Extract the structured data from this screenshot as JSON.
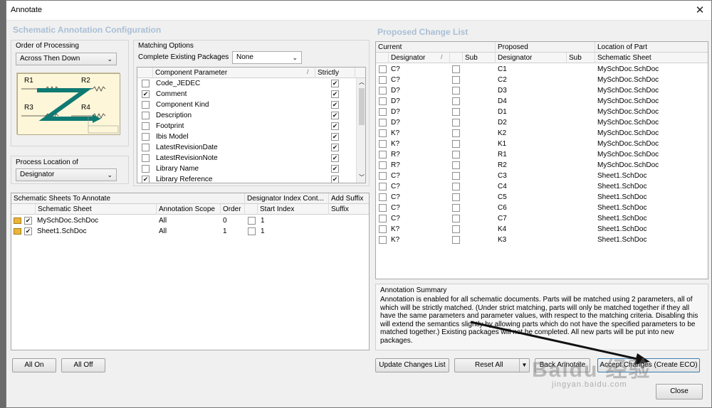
{
  "window": {
    "title": "Annotate"
  },
  "left": {
    "section_title": "Schematic Annotation Configuration",
    "order": {
      "label": "Order of Processing",
      "value": "Across Then Down",
      "diagram": {
        "r1": "R1",
        "r2": "R2",
        "r3": "R3",
        "r4": "R4"
      }
    },
    "process_location": {
      "label": "Process Location of",
      "value": "Designator"
    },
    "matching": {
      "label": "Matching Options",
      "complete_label": "Complete Existing Packages",
      "complete_value": "None",
      "grid_headers": {
        "param": "Component Parameter",
        "strictly": "Strictly"
      },
      "params": [
        {
          "name": "Code_JEDEC",
          "checked": false,
          "strictly": true
        },
        {
          "name": "Comment",
          "checked": true,
          "strictly": true
        },
        {
          "name": "Component Kind",
          "checked": false,
          "strictly": true
        },
        {
          "name": "Description",
          "checked": false,
          "strictly": true
        },
        {
          "name": "Footprint",
          "checked": false,
          "strictly": true
        },
        {
          "name": "Ibis Model",
          "checked": false,
          "strictly": true
        },
        {
          "name": "LatestRevisionDate",
          "checked": false,
          "strictly": true
        },
        {
          "name": "LatestRevisionNote",
          "checked": false,
          "strictly": true
        },
        {
          "name": "Library Name",
          "checked": false,
          "strictly": true
        },
        {
          "name": "Library Reference",
          "checked": true,
          "strictly": true
        }
      ]
    },
    "sheets": {
      "group_headers": {
        "sheets": "Schematic Sheets To Annotate",
        "designator": "Designator Index Cont...",
        "suffix": "Add Suffix"
      },
      "col_headers": {
        "sheet": "Schematic Sheet",
        "scope": "Annotation Scope",
        "order": "Order",
        "start": "Start Index",
        "suffix": "Suffix"
      },
      "rows": [
        {
          "sheet": "MySchDoc.SchDoc",
          "scope": "All",
          "order": "0",
          "start": "1"
        },
        {
          "sheet": "Sheet1.SchDoc",
          "scope": "All",
          "order": "1",
          "start": "1"
        }
      ]
    },
    "buttons": {
      "all_on": "All On",
      "all_off": "All Off"
    }
  },
  "right": {
    "section_title": "Proposed Change List",
    "group_headers": {
      "current": "Current",
      "proposed": "Proposed",
      "location": "Location of Part"
    },
    "col_headers": {
      "designator": "Designator",
      "sub": "Sub",
      "pdesignator": "Designator",
      "psub": "Sub",
      "sheet": "Schematic Sheet"
    },
    "rows": [
      {
        "cur": "C?",
        "prop": "C1",
        "sheet": "MySchDoc.SchDoc"
      },
      {
        "cur": "C?",
        "prop": "C2",
        "sheet": "MySchDoc.SchDoc"
      },
      {
        "cur": "D?",
        "prop": "D3",
        "sheet": "MySchDoc.SchDoc"
      },
      {
        "cur": "D?",
        "prop": "D4",
        "sheet": "MySchDoc.SchDoc"
      },
      {
        "cur": "D?",
        "prop": "D1",
        "sheet": "MySchDoc.SchDoc"
      },
      {
        "cur": "D?",
        "prop": "D2",
        "sheet": "MySchDoc.SchDoc"
      },
      {
        "cur": "K?",
        "prop": "K2",
        "sheet": "MySchDoc.SchDoc"
      },
      {
        "cur": "K?",
        "prop": "K1",
        "sheet": "MySchDoc.SchDoc"
      },
      {
        "cur": "R?",
        "prop": "R1",
        "sheet": "MySchDoc.SchDoc"
      },
      {
        "cur": "R?",
        "prop": "R2",
        "sheet": "MySchDoc.SchDoc"
      },
      {
        "cur": "C?",
        "prop": "C3",
        "sheet": "Sheet1.SchDoc"
      },
      {
        "cur": "C?",
        "prop": "C4",
        "sheet": "Sheet1.SchDoc"
      },
      {
        "cur": "C?",
        "prop": "C5",
        "sheet": "Sheet1.SchDoc"
      },
      {
        "cur": "C?",
        "prop": "C6",
        "sheet": "Sheet1.SchDoc"
      },
      {
        "cur": "C?",
        "prop": "C7",
        "sheet": "Sheet1.SchDoc"
      },
      {
        "cur": "K?",
        "prop": "K4",
        "sheet": "Sheet1.SchDoc"
      },
      {
        "cur": "K?",
        "prop": "K3",
        "sheet": "Sheet1.SchDoc"
      }
    ],
    "summary": {
      "title": "Annotation Summary",
      "text": "Annotation is enabled for all schematic documents. Parts will be matched using 2 parameters, all of which will be strictly matched. (Under strict matching, parts will only be matched together if they all have the same parameters and parameter values, with respect to the matching criteria. Disabling this will extend the semantics slightly by allowing parts which do not have the specified parameters to be matched together.) Existing packages will not be completed. All new parts will be put into new packages."
    },
    "buttons": {
      "update": "Update Changes List",
      "reset": "Reset All",
      "back": "Back Annotate",
      "accept": "Accept Changes (Create ECO)",
      "close": "Close"
    }
  },
  "watermark": {
    "main": "Baidu 经验",
    "sub": "jingyan.baidu.com"
  },
  "colors": {
    "section_title": "#a9bfd6",
    "arrow": "#0f7a73",
    "diagram_bg": "#fdf6d8"
  }
}
